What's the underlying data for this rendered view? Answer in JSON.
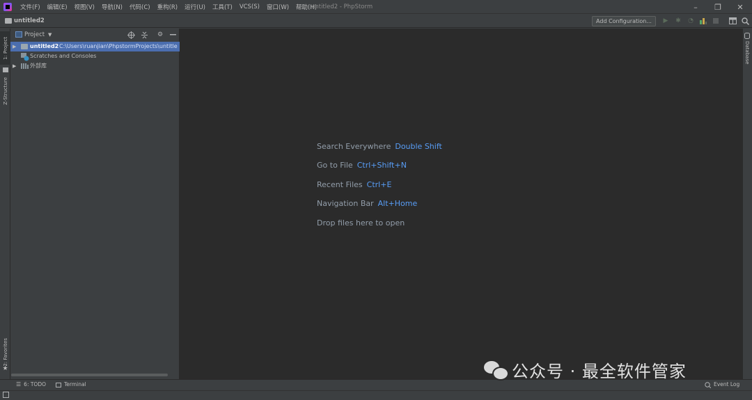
{
  "menu": [
    "文件(F)",
    "编辑(E)",
    "视图(V)",
    "导航(N)",
    "代码(C)",
    "重构(R)",
    "运行(U)",
    "工具(T)",
    "VCS(S)",
    "窗口(W)",
    "帮助(H)"
  ],
  "window_title": "untitled2 - PhpStorm",
  "window_controls": {
    "minimize": "–",
    "restore": "❐",
    "close": "✕"
  },
  "nav": {
    "project_name": "untitled2",
    "add_configuration": "Add Configuration..."
  },
  "toolbar_icons": [
    "run-icon",
    "debug-icon",
    "coverage-icon",
    "profile-icon",
    "stop-icon",
    "project-structure-icon",
    "search-icon"
  ],
  "left_stripe": {
    "project_tab": "1: Project",
    "structure_tab": "Z-Structure",
    "favorites_tab": "2: Favorites"
  },
  "project_panel": {
    "view_label": "Project",
    "tree": [
      {
        "name": "untitled2",
        "path": "C:\\Users\\ruanjian\\PhpstormProjects\\untitle"
      },
      {
        "name": "Scratches and Consoles"
      },
      {
        "name": "外部库"
      }
    ]
  },
  "editor_hints": [
    {
      "label": "Search Everywhere",
      "key": "Double Shift"
    },
    {
      "label": "Go to File",
      "key": "Ctrl+Shift+N"
    },
    {
      "label": "Recent Files",
      "key": "Ctrl+E"
    },
    {
      "label": "Navigation Bar",
      "key": "Alt+Home"
    },
    {
      "label": "Drop files here to open",
      "key": ""
    }
  ],
  "right_stripe": {
    "database_tab": "Database"
  },
  "bottom_tabs": {
    "todo": "6: TODO",
    "terminal": "Terminal",
    "event_log": "Event Log"
  },
  "watermark": "公众号 · 最全软件管家",
  "colors": {
    "background": "#3c3f41",
    "editor": "#2b2b2b",
    "selection": "#4b6eaf",
    "key_accent": "#589df6"
  }
}
